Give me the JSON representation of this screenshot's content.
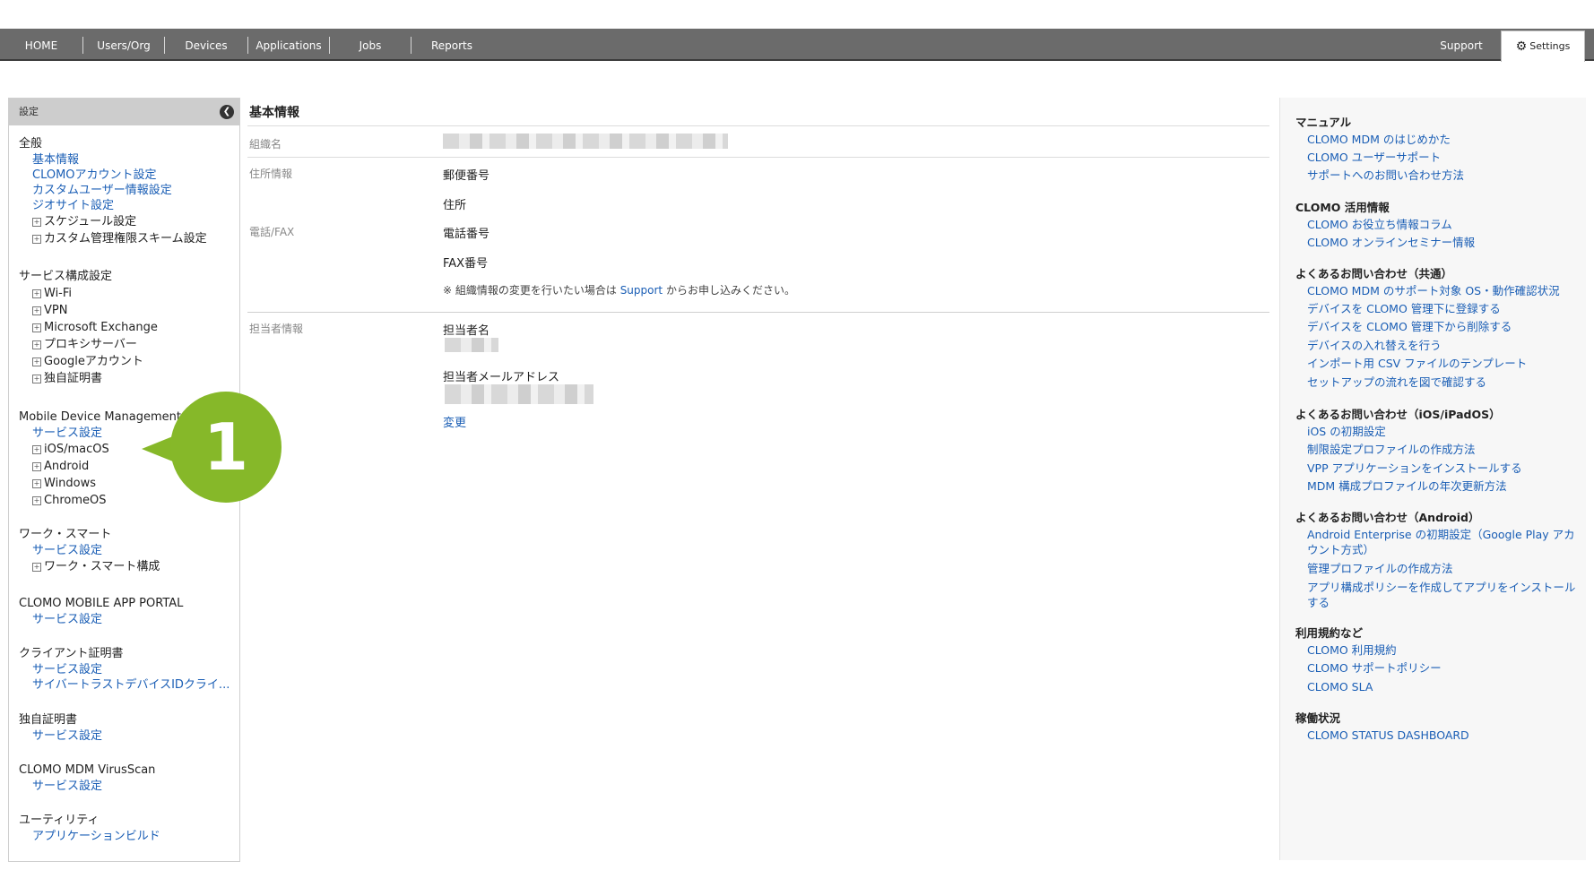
{
  "nav": {
    "items": [
      "HOME",
      "Users/Org",
      "Devices",
      "Applications",
      "Jobs",
      "Reports"
    ],
    "support": "Support",
    "settings": "Settings"
  },
  "sidebar": {
    "header": "設定",
    "sections": {
      "general": {
        "title": "全般",
        "links": [
          "基本情報",
          "CLOMOアカウント設定",
          "カスタムユーザー情報設定",
          "ジオサイト設定"
        ],
        "expandables": [
          "スケジュール設定",
          "カスタム管理権限スキーム設定"
        ]
      },
      "service": {
        "title": "サービス構成設定",
        "expandables": [
          "Wi-Fi",
          "VPN",
          "Microsoft Exchange",
          "プロキシサーバー",
          "Googleアカウント",
          "独自証明書"
        ]
      },
      "mdm": {
        "title": "Mobile Device Management",
        "link": "サービス設定",
        "expandables": [
          "iOS/macOS",
          "Android",
          "Windows",
          "ChromeOS"
        ]
      },
      "worksmart": {
        "title": "ワーク・スマート",
        "link": "サービス設定",
        "expandable": "ワーク・スマート構成"
      },
      "appportal": {
        "title": "CLOMO MOBILE APP PORTAL",
        "link": "サービス設定"
      },
      "clientcert": {
        "title": "クライアント証明書",
        "links": [
          "サービス設定",
          "サイバートラストデバイスIDクライ..."
        ]
      },
      "owncert": {
        "title": "独自証明書",
        "link": "サービス設定"
      },
      "virusscan": {
        "title": "CLOMO MDM VirusScan",
        "link": "サービス設定"
      },
      "utility": {
        "title": "ユーティリティ",
        "link": "アプリケーションビルド"
      }
    }
  },
  "main": {
    "title": "基本情報",
    "org_label": "組織名",
    "address_label": "住所情報",
    "postal": "郵便番号",
    "address": "住所",
    "phone_label": "電話/FAX",
    "phone": "電話番号",
    "fax": "FAX番号",
    "notice_before": "※ 組織情報の変更を行いたい場合は ",
    "notice_link": "Support",
    "notice_after": " からお申し込みください。",
    "contact_label": "担当者情報",
    "contact_name": "担当者名",
    "contact_email": "担当者メールアドレス",
    "change": "変更"
  },
  "callout": {
    "number": "1",
    "color": "#86b829"
  },
  "right": {
    "manual": {
      "title": "マニュアル",
      "links": [
        "CLOMO MDM のはじめかた",
        "CLOMO ユーザーサポート",
        "サポートへのお問い合わせ方法"
      ]
    },
    "usage": {
      "title": "CLOMO 活用情報",
      "links": [
        "CLOMO お役立ち情報コラム",
        "CLOMO オンラインセミナー情報"
      ]
    },
    "faq_common": {
      "title": "よくあるお問い合わせ（共通）",
      "links": [
        "CLOMO MDM のサポート対象 OS・動作確認状況",
        "デバイスを CLOMO 管理下に登録する",
        "デバイスを CLOMO 管理下から削除する",
        "デバイスの入れ替えを行う",
        "インポート用 CSV ファイルのテンプレート",
        "セットアップの流れを図で確認する"
      ]
    },
    "faq_ios": {
      "title": "よくあるお問い合わせ（iOS/iPadOS）",
      "links": [
        "iOS の初期設定",
        "制限設定プロファイルの作成方法",
        "VPP アプリケーションをインストールする",
        "MDM 構成プロファイルの年次更新方法"
      ]
    },
    "faq_android": {
      "title": "よくあるお問い合わせ（Android）",
      "links": [
        "Android Enterprise の初期設定（Google Play アカウント方式）",
        "管理プロファイルの作成方法",
        "アプリ構成ポリシーを作成してアプリをインストールする"
      ]
    },
    "terms": {
      "title": "利用規約など",
      "links": [
        "CLOMO 利用規約",
        "CLOMO サポートポリシー",
        "CLOMO SLA"
      ]
    },
    "status": {
      "title": "稼働状況",
      "links": [
        "CLOMO STATUS DASHBOARD"
      ]
    }
  }
}
